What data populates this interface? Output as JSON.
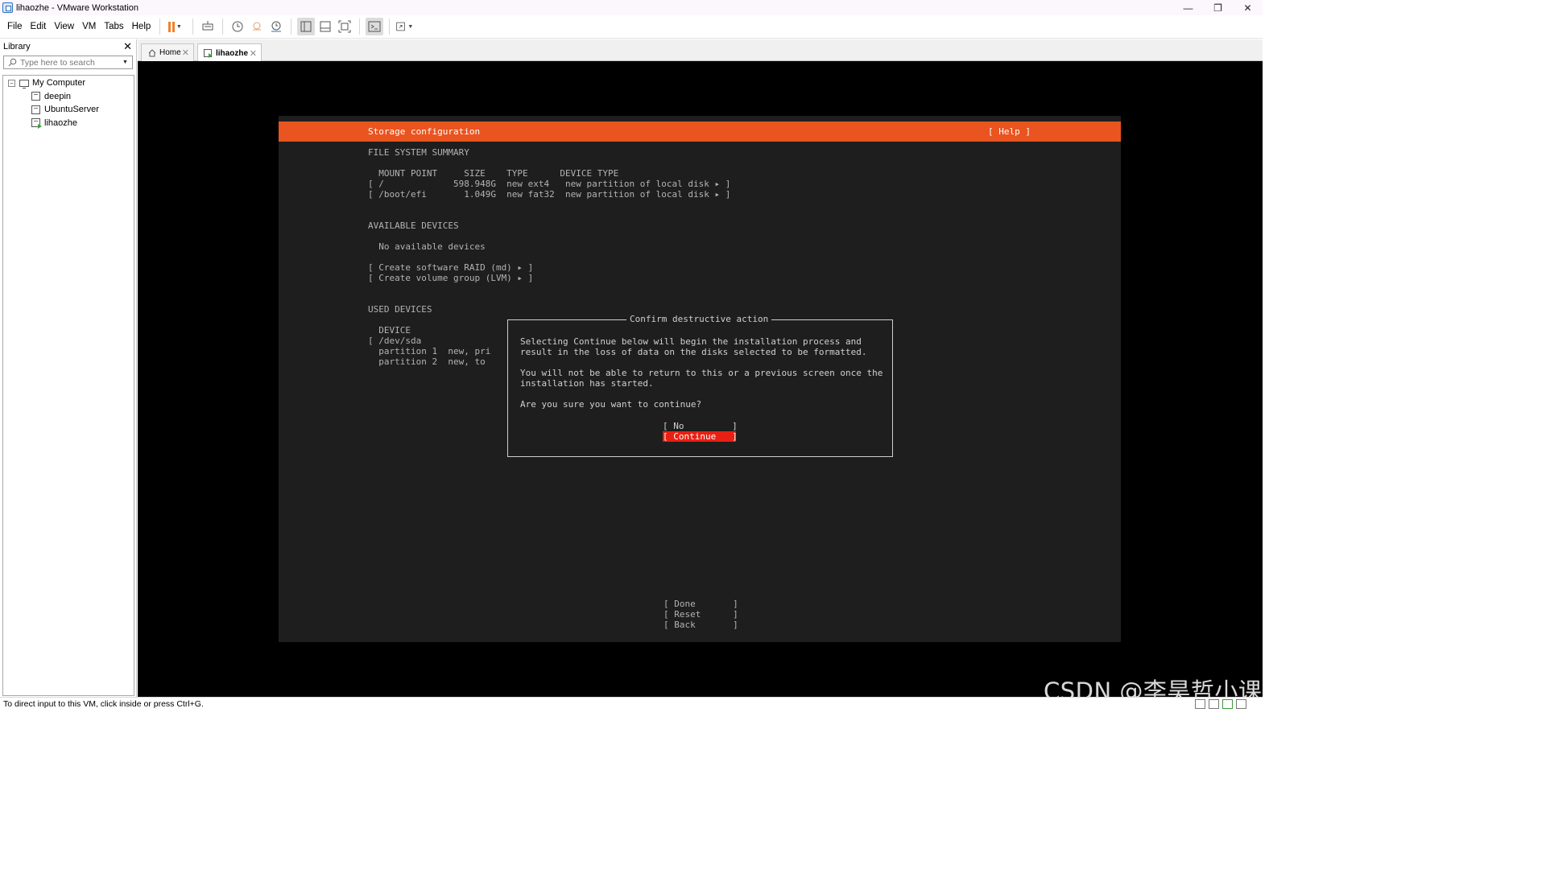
{
  "window": {
    "title": "lihaozhe - VMware Workstation",
    "minimize": "—",
    "restore": "❐",
    "close": "✕"
  },
  "menu": [
    "File",
    "Edit",
    "View",
    "VM",
    "Tabs",
    "Help"
  ],
  "library": {
    "title": "Library",
    "search_placeholder": "Type here to search",
    "root": "My Computer",
    "vms": [
      "deepin",
      "UbuntuServer",
      "lihaozhe"
    ],
    "selected_vm": "lihaozhe"
  },
  "tabs": [
    {
      "label": "Home",
      "icon": "home-icon"
    },
    {
      "label": "lihaozhe",
      "icon": "vm-running-icon",
      "active": true
    }
  ],
  "installer": {
    "header_title": "Storage configuration",
    "help": "[ Help ]",
    "fs_summary_heading": "FILE SYSTEM SUMMARY",
    "fs_columns": "  MOUNT POINT     SIZE    TYPE      DEVICE TYPE",
    "fs_rows": [
      "[ /             598.948G  new ext4   new partition of local disk ▸ ]",
      "[ /boot/efi       1.049G  new fat32  new partition of local disk ▸ ]"
    ],
    "available_heading": "AVAILABLE DEVICES",
    "no_devices": "  No available devices",
    "create_raid": "[ Create software RAID (md) ▸ ]",
    "create_lvm": "[ Create volume group (LVM) ▸ ]",
    "used_heading": "USED DEVICES",
    "used_lines": [
      "  DEVICE",
      "[ /dev/sda",
      "  partition 1  new, pri",
      "  partition 2  new, to"
    ],
    "done": "[ Done       ]",
    "reset": "[ Reset      ]",
    "back": "[ Back       ]"
  },
  "dialog": {
    "title": "Confirm destructive action",
    "lines": [
      "Selecting Continue below will begin the installation process and",
      "result in the loss of data on the disks selected to be formatted.",
      "You will not be able to return to this or a previous screen once the",
      "installation has started.",
      "Are you sure you want to continue?"
    ],
    "no_button": "[ No         ]",
    "continue_button": "[ Continue   ]"
  },
  "watermark": "CSDN @李昊哲小课",
  "status": "To direct input to this VM, click inside or press Ctrl+G.",
  "colors": {
    "ubuntu_orange": "#e95420",
    "selection_red": "#e81f12",
    "pause_orange": "#f0812b"
  }
}
